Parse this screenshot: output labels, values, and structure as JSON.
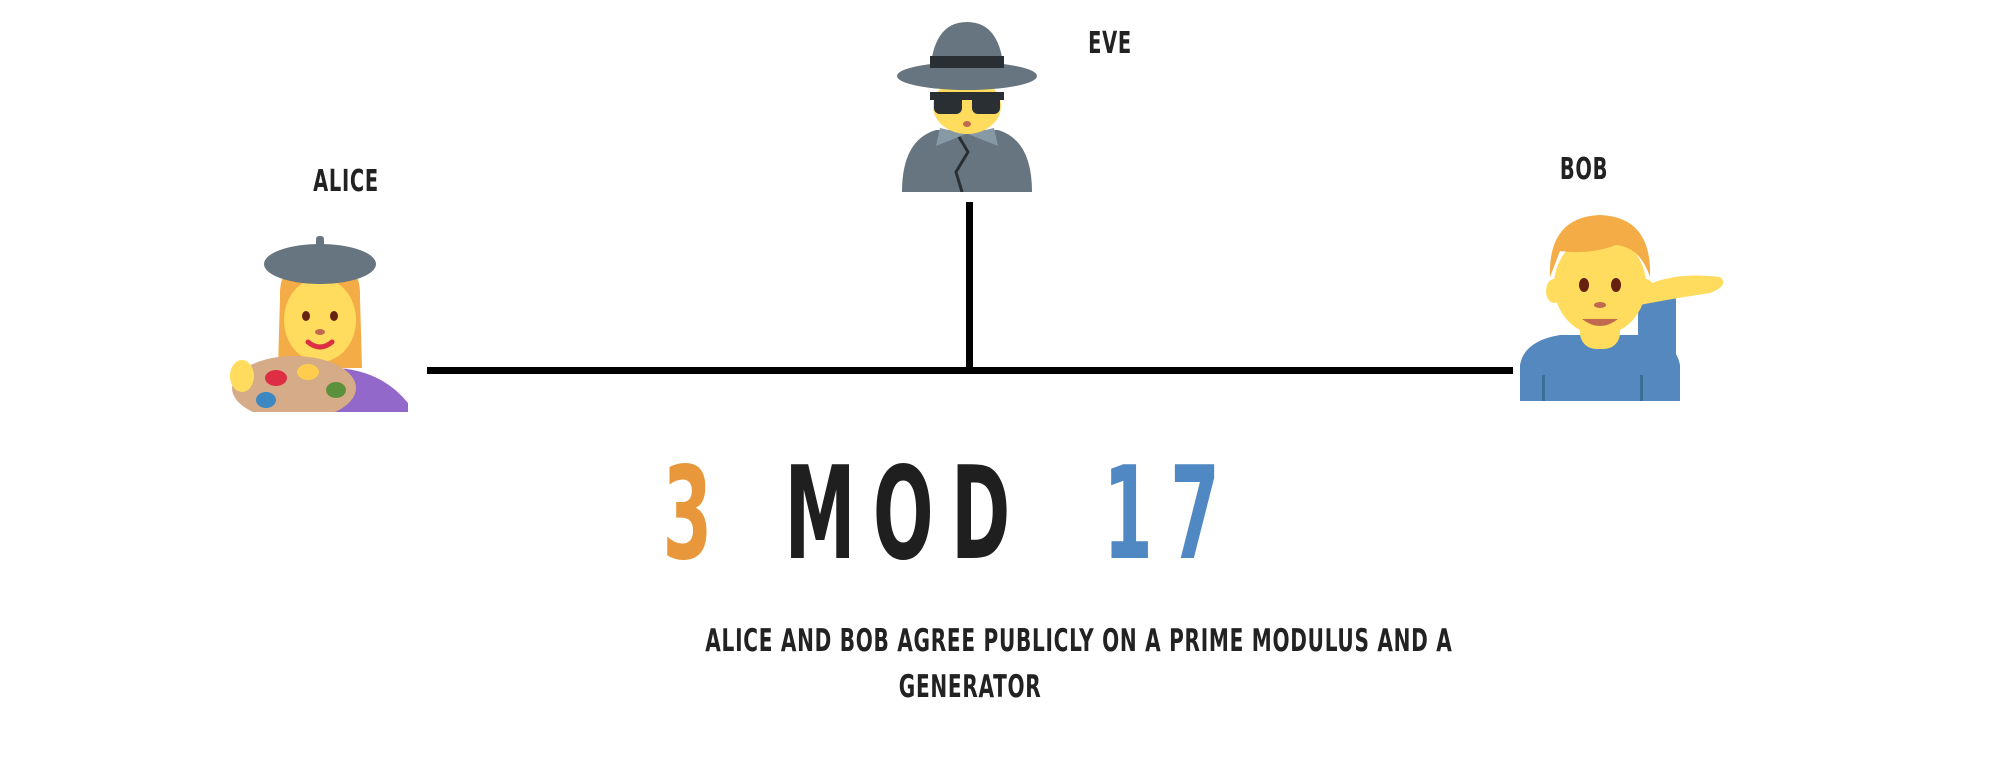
{
  "participants": {
    "alice": {
      "label": "ALICE",
      "icon": "artist-woman-icon"
    },
    "eve": {
      "label": "EVE",
      "icon": "spy-detective-icon"
    },
    "bob": {
      "label": "BOB",
      "icon": "tipping-hand-man-icon"
    }
  },
  "equation": {
    "generator": "3",
    "operator": "MOD",
    "prime": "17",
    "generator_color": "#E8973A",
    "prime_color": "#4F88C2"
  },
  "caption": {
    "line1": "ALICE AND BOB AGREE PUBLICLY ON A PRIME MODULUS AND A",
    "line2": "GENERATOR"
  }
}
